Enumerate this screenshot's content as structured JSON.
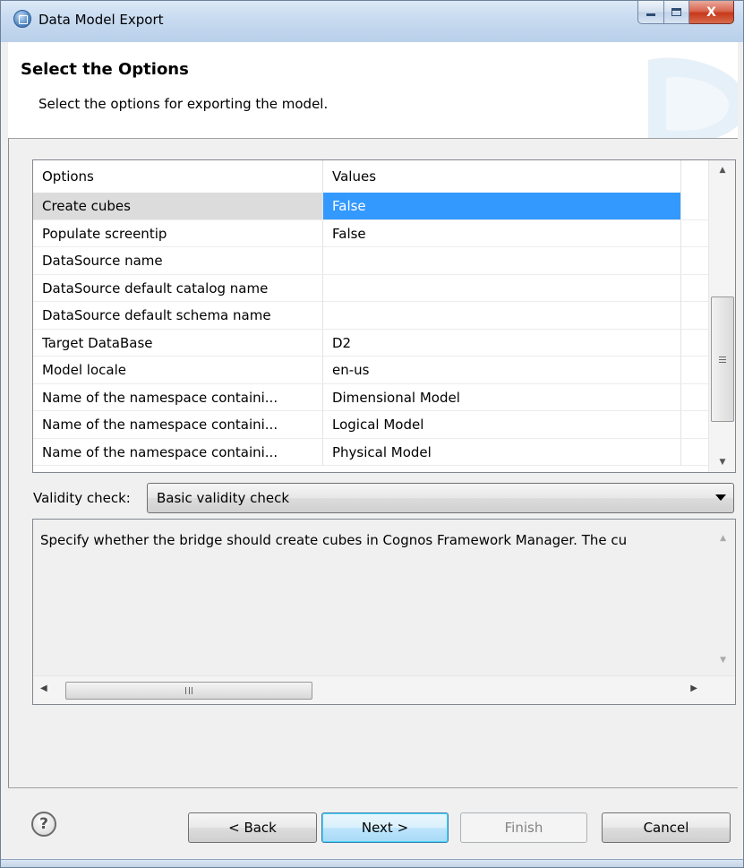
{
  "window": {
    "title": "Data Model Export",
    "min_icon": "minimize-icon",
    "max_icon": "maximize-icon",
    "close_label": "X"
  },
  "header": {
    "title": "Select the Options",
    "description": "Select the options for exporting the model."
  },
  "options_table": {
    "columns": [
      "Options",
      "Values"
    ],
    "selected_row": 0,
    "rows": [
      {
        "option": "Create cubes",
        "value": "False"
      },
      {
        "option": "Populate screentip",
        "value": "False"
      },
      {
        "option": "DataSource name",
        "value": ""
      },
      {
        "option": "DataSource default catalog name",
        "value": ""
      },
      {
        "option": "DataSource default schema name",
        "value": ""
      },
      {
        "option": "Target DataBase",
        "value": "D2"
      },
      {
        "option": "Model locale",
        "value": "en-us"
      },
      {
        "option": "Name of the namespace containi...",
        "value": "Dimensional Model"
      },
      {
        "option": "Name of the namespace containi...",
        "value": "Logical Model"
      },
      {
        "option": "Name of the namespace containi...",
        "value": "Physical Model"
      }
    ]
  },
  "validity": {
    "label": "Validity check:",
    "selected": "Basic validity check"
  },
  "description_text": "Specify whether the bridge should create cubes in Cognos Framework Manager.  The cu",
  "footer": {
    "help_label": "?",
    "back_label": "< Back",
    "next_label": "Next >",
    "finish_label": "Finish",
    "cancel_label": "Cancel"
  },
  "colors": {
    "selection": "#3399ff",
    "titlebar": "#c7daf0",
    "close_button": "#c7381b"
  }
}
